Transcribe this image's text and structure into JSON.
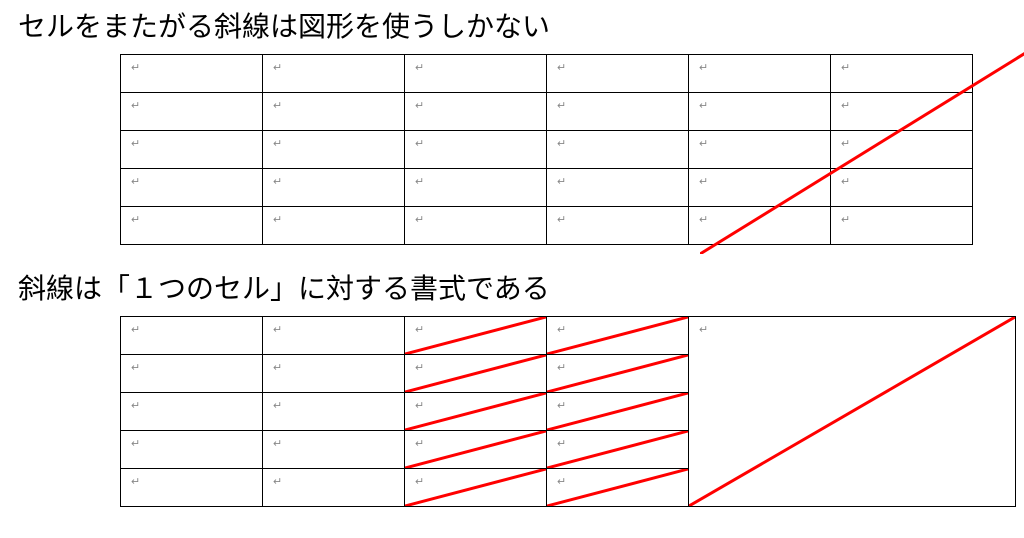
{
  "heading1": "セルをまたがる斜線は図形を使うしかない",
  "heading2": "斜線は「１つのセル」に対する書式である",
  "cell_mark": "↵",
  "table1": {
    "rows": 5,
    "cols": 6
  },
  "table2": {
    "rows": 5,
    "cols": 5,
    "diag_cells_col3": true,
    "diag_cells_col4": true,
    "merged_col5_diag": true
  },
  "diag_color": "#ff0000"
}
